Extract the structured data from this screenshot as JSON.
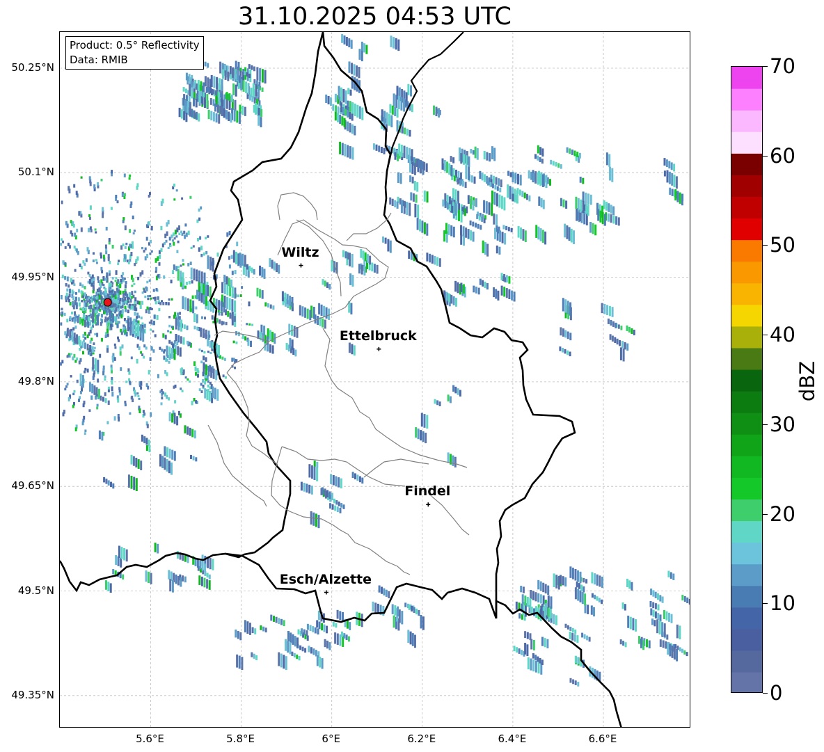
{
  "title": "31.10.2025 04:53 UTC",
  "info": {
    "product": "Product: 0.5° Reflectivity",
    "source": "Data: RMIB"
  },
  "map": {
    "lon_range": [
      5.4,
      6.8
    ],
    "lat_range": [
      49.3,
      50.3
    ],
    "lat_labels": [
      "50.25°N",
      "50.1°N",
      "49.95°N",
      "49.8°N",
      "49.65°N",
      "49.5°N",
      "49.35°N"
    ],
    "lon_labels": [
      "5.6°E",
      "5.8°E",
      "6°E",
      "6.2°E",
      "6.4°E",
      "6.6°E"
    ],
    "radar_site": {
      "lon": 5.505,
      "lat": 49.914,
      "color": "#e8141c"
    },
    "cities": [
      {
        "name": "Wiltz",
        "lon": 5.932,
        "lat": 49.967
      },
      {
        "name": "Ettelbruck",
        "lon": 6.104,
        "lat": 49.847
      },
      {
        "name": "Findel",
        "lon": 6.213,
        "lat": 49.624
      },
      {
        "name": "Esch/Alzette",
        "lon": 5.988,
        "lat": 49.498
      }
    ]
  },
  "colorbar": {
    "label": "dBZ",
    "ticks": [
      "0",
      "10",
      "20",
      "30",
      "40",
      "50",
      "60",
      "70"
    ],
    "min": 0,
    "max": 70,
    "colors": [
      "#6474a8",
      "#56699f",
      "#4a5fa0",
      "#4466a8",
      "#4a7cb4",
      "#5b9cc8",
      "#6cc4dc",
      "#5fd6c6",
      "#3ecf6c",
      "#14c82a",
      "#12b822",
      "#10a418",
      "#0f9014",
      "#0c7c10",
      "#0a660e",
      "#4a7a14",
      "#aab00a",
      "#f6d600",
      "#f8b400",
      "#fa9800",
      "#fa7a00",
      "#e00000",
      "#c00000",
      "#a00000",
      "#7a0000",
      "#fde0ff",
      "#fcb8ff",
      "#fc80ff",
      "#ee44f0"
    ]
  }
}
